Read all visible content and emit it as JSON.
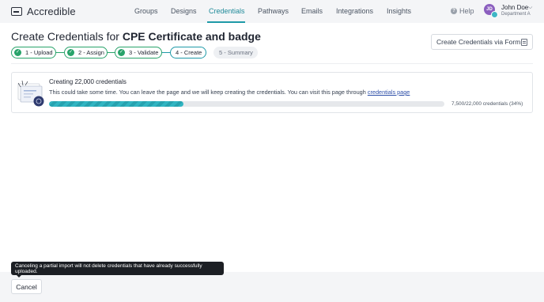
{
  "app": {
    "name": "Accredible"
  },
  "nav": {
    "items": [
      {
        "label": "Groups"
      },
      {
        "label": "Designs"
      },
      {
        "label": "Credentials"
      },
      {
        "label": "Pathways"
      },
      {
        "label": "Emails"
      },
      {
        "label": "Integrations"
      },
      {
        "label": "Insights"
      }
    ],
    "active": "Credentials",
    "help": "Help"
  },
  "user": {
    "initials": "JD",
    "name": "John Doe",
    "department": "Department A"
  },
  "header": {
    "title_prefix": "Create Credentials for",
    "title_bold": "CPE Certificate and badge",
    "form_button": "Create Credentials via Form"
  },
  "steps": [
    {
      "label": "1 - Upload",
      "state": "done"
    },
    {
      "label": "2 - Assign",
      "state": "done"
    },
    {
      "label": "3 - Validate",
      "state": "done"
    },
    {
      "label": "4 - Create",
      "state": "current"
    },
    {
      "label": "5 - Summary",
      "state": "pending"
    }
  ],
  "progress": {
    "title": "Creating 22,000 credentials",
    "description": "This could take some time. You can leave the page and we will keep creating the credentials. You can visit this page through",
    "link": "credentials page",
    "fraction": 0.34,
    "status": "7,500/22,000 credentials (34%)"
  },
  "footer": {
    "cancel_label": "Cancel",
    "tooltip": "Canceling a partial import will not delete credentials that have already successfully uploaded."
  },
  "colors": {
    "accent": "#1f9aa8",
    "success": "#28a36a",
    "progress_fill": "#31b5c2",
    "link": "#2e4fa8",
    "avatar": "#8b5fbf"
  },
  "icons": [
    "accredible-logo-icon",
    "help-icon",
    "chevron-down-icon",
    "form-icon",
    "check-icon",
    "certificate-illustration"
  ]
}
